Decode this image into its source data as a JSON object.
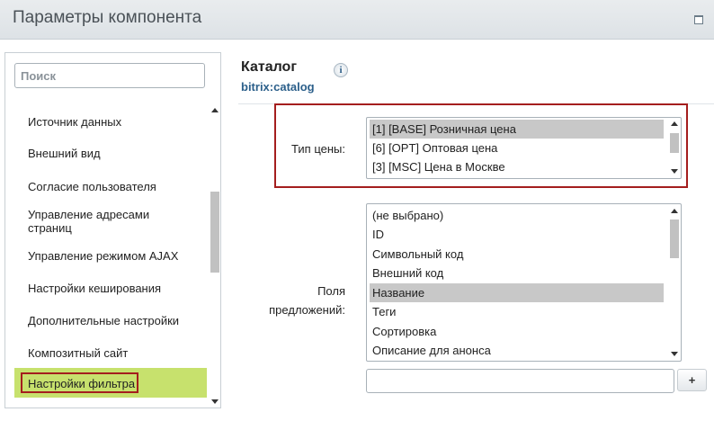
{
  "window": {
    "title": "Параметры компонента",
    "maximize_icon": "maximize-icon"
  },
  "sidebar": {
    "search_placeholder": "Поиск",
    "items": [
      {
        "label": "Источник данных"
      },
      {
        "label": "Внешний вид"
      },
      {
        "label": "Согласие пользователя"
      },
      {
        "label": "Управление адресами страниц"
      },
      {
        "label": "Управление режимом AJAX"
      },
      {
        "label": "Настройки кеширования"
      },
      {
        "label": "Дополнительные настройки"
      },
      {
        "label": "Композитный сайт"
      },
      {
        "label": "Настройки фильтра",
        "active": true
      }
    ]
  },
  "component": {
    "title": "Каталог",
    "code": "bitrix:catalog",
    "info_icon_glyph": "i"
  },
  "price_type": {
    "label": "Тип цены:",
    "options": [
      {
        "label": "[1] [BASE] Розничная цена",
        "selected": true
      },
      {
        "label": "[6] [OPT] Оптовая цена",
        "selected": false
      },
      {
        "label": "[3] [MSC] Цена в Москве",
        "selected": false
      }
    ]
  },
  "offer_fields": {
    "label_line1": "Поля",
    "label_line2": "предложений:",
    "options": [
      {
        "label": "(не выбрано)",
        "selected": false
      },
      {
        "label": "ID",
        "selected": false
      },
      {
        "label": "Символьный код",
        "selected": false
      },
      {
        "label": "Внешний код",
        "selected": false
      },
      {
        "label": "Название",
        "selected": true
      },
      {
        "label": "Теги",
        "selected": false
      },
      {
        "label": "Сортировка",
        "selected": false
      },
      {
        "label": "Описание для анонса",
        "selected": false
      }
    ],
    "add_input_value": "",
    "add_button_label": "+"
  },
  "colors": {
    "accent_green": "#c7e16d",
    "highlight_red": "#a41e1e",
    "code_blue": "#2b5f8a"
  }
}
